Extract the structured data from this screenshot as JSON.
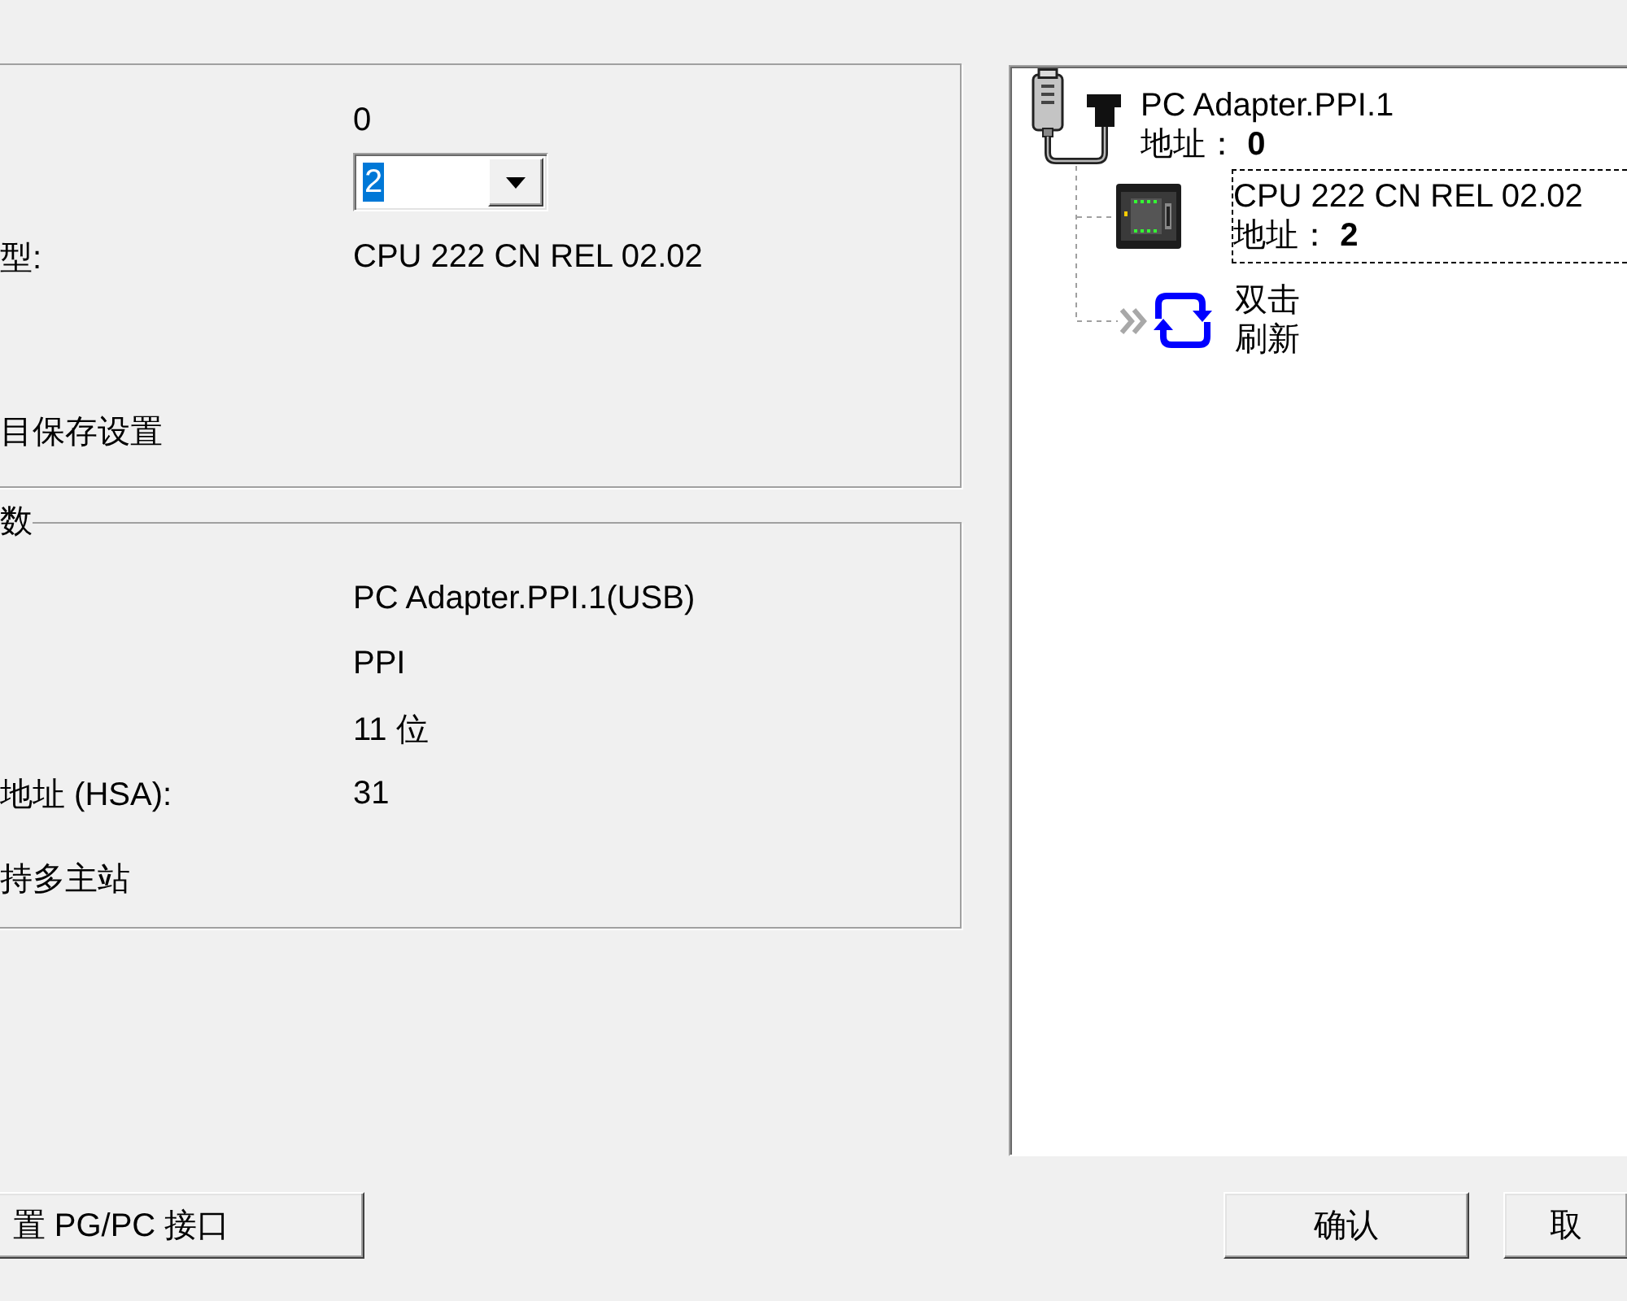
{
  "settings": {
    "rows": [
      {
        "kind": "text",
        "value": "0"
      },
      {
        "kind": "combo",
        "value": "2",
        "highlighted": true
      },
      {
        "kind": "text",
        "label": "型:",
        "value": "CPU 222 CN REL 02.02"
      },
      {
        "kind": "note",
        "label": "目保存设置"
      }
    ]
  },
  "parameters": {
    "title": "数",
    "rows": [
      {
        "kind": "text",
        "value": "PC Adapter.PPI.1(USB)"
      },
      {
        "kind": "text",
        "value": "PPI"
      },
      {
        "kind": "text",
        "value": "11 位"
      },
      {
        "kind": "text",
        "label": "地址 (HSA):",
        "value": "31"
      },
      {
        "kind": "note",
        "label": "持多主站"
      }
    ]
  },
  "tree": {
    "kind": "adapter",
    "name": "PC Adapter.PPI.1",
    "address": "地址： **0**",
    "selected": false,
    "children": [
      {
        "kind": "cpu",
        "name": "CPU 222 CN REL 02.02",
        "address": "地址： **2**",
        "selected": true
      },
      {
        "kind": "refresh",
        "label": "双击刷新",
        "selected": false
      }
    ]
  },
  "footer_left_button": {
    "label": "置 PG/PC 接口"
  },
  "footer_buttons": [
    {
      "label": "确认"
    },
    {
      "label": "取"
    }
  ]
}
